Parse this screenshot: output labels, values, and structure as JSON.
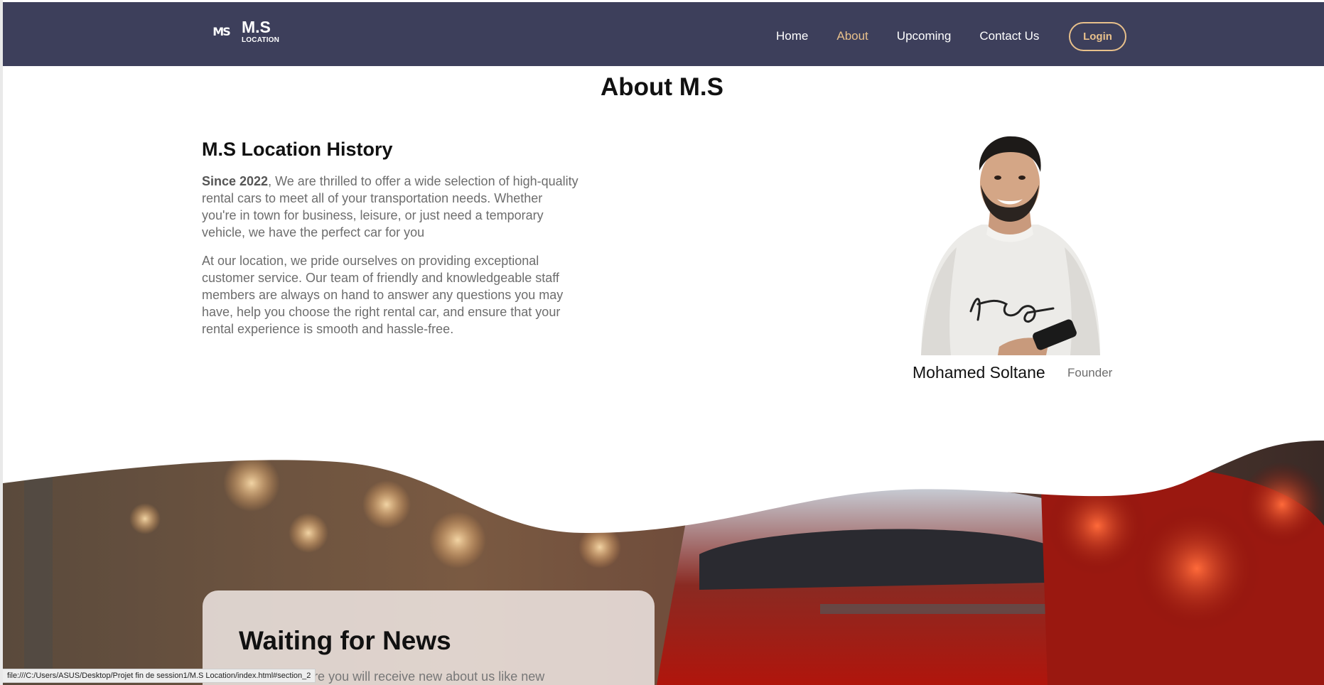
{
  "header": {
    "brand_mark": "MS",
    "brand_name": "M.S",
    "brand_sub": "LOCATION",
    "nav": [
      {
        "label": "Home",
        "active": false
      },
      {
        "label": "About",
        "active": true
      },
      {
        "label": "Upcoming",
        "active": false
      },
      {
        "label": "Contact Us",
        "active": false
      }
    ],
    "login_label": "Login",
    "accent_color": "#e8c08b",
    "background_color": "#3d3f5b"
  },
  "about": {
    "title": "About M.S",
    "history_title": "M.S Location History",
    "para1_bold": "Since 2022",
    "para1_rest": ", We are thrilled to offer a wide selection of high-quality rental cars to meet all of your transportation needs. Whether you're in town for business, leisure, or just need a temporary vehicle, we have the perfect car for you",
    "para2": "At our location, we pride ourselves on providing exceptional customer service. Our team of friendly and knowledgeable staff members are always on hand to answer any questions you may have, help you choose the right rental car, and ensure that your rental experience is smooth and hassle-free."
  },
  "founder": {
    "name": "Mohamed Soltane",
    "role": "Founder"
  },
  "newsletter": {
    "title": "Waiting for News",
    "text": "Subscribe here you will receive new about us like new"
  },
  "status_bar": {
    "url": "file:///C:/Users/ASUS/Desktop/Projet fin de session1/M.S Location/index.html#section_2"
  }
}
